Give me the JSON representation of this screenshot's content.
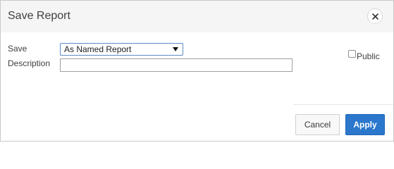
{
  "dialog": {
    "title": "Save Report",
    "close_icon": "close-icon"
  },
  "form": {
    "save_label": "Save",
    "save_select": {
      "value": "As Named Report",
      "arrow_icon": "dropdown-arrow-icon"
    },
    "description_label": "Description",
    "description_value": "",
    "description_placeholder": "",
    "public_label": "Public",
    "public_checked": false
  },
  "footer": {
    "cancel_label": "Cancel",
    "apply_label": "Apply"
  },
  "colors": {
    "apply_button": "#2a77cc",
    "title_bar": "#f5f5f5",
    "select_border": "#5b8ac7"
  }
}
